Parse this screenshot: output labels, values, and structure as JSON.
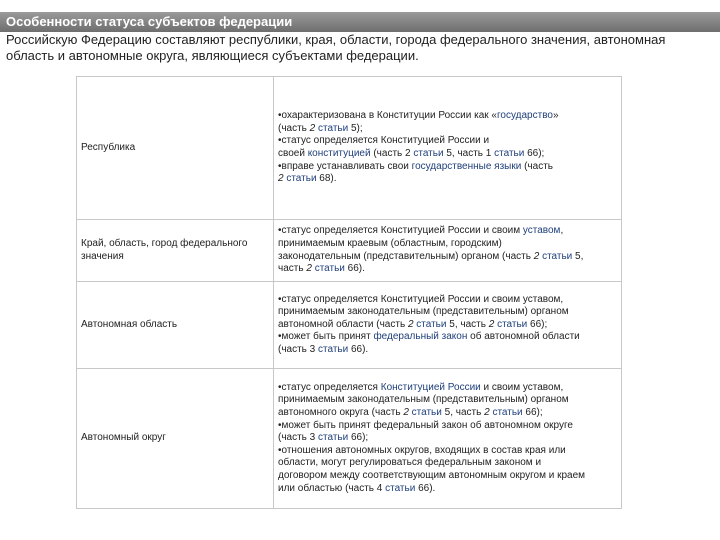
{
  "title": "Особенности статуса субъектов федерации",
  "intro": "Российскую Федерацию составляют республики, края, области, города федерального значения, автономная область и автономные округа, являющиеся субъектами федерации.",
  "rows": [
    {
      "name": "Республика",
      "lines": [
        [
          {
            "t": "•охарактеризована в Конституции России как «"
          },
          {
            "t": "государство",
            "link": true
          },
          {
            "t": "»"
          }
        ],
        [
          {
            "t": "(часть "
          },
          {
            "t": "2 ",
            "i": true
          },
          {
            "t": "статьи",
            "link": true
          },
          {
            "t": " 5);"
          }
        ],
        [
          {
            "t": "•статус определяется Конституцией России и"
          }
        ],
        [
          {
            "t": "своей "
          },
          {
            "t": "конституцией",
            "link": true
          },
          {
            "t": " (часть 2 "
          },
          {
            "t": "статьи",
            "link": true
          },
          {
            "t": " 5, часть 1 "
          },
          {
            "t": "статьи",
            "link": true
          },
          {
            "t": " 66);"
          }
        ],
        [
          {
            "t": "•вправе устанавливать свои "
          },
          {
            "t": "государственные языки",
            "link": true
          },
          {
            "t": " (часть"
          }
        ],
        [
          {
            "t": "2 ",
            "i": true
          },
          {
            "t": "статьи",
            "link": true
          },
          {
            "t": " 68)."
          }
        ]
      ]
    },
    {
      "name": "Край, область, город федерального значения",
      "lines": [
        [
          {
            "t": "•статус определяется Конституцией России и своим "
          },
          {
            "t": "уставом",
            "link": true
          },
          {
            "t": ","
          }
        ],
        [
          {
            "t": "принимаемым краевым (областным, городским)"
          }
        ],
        [
          {
            "t": "законодательным (представительным) органом (часть "
          },
          {
            "t": "2 ",
            "i": true
          },
          {
            "t": "статьи",
            "link": true
          },
          {
            "t": " 5,"
          }
        ],
        [
          {
            "t": "часть "
          },
          {
            "t": "2 ",
            "i": true
          },
          {
            "t": "статьи",
            "link": true
          },
          {
            "t": " 66)."
          }
        ]
      ]
    },
    {
      "name": "Автономная область",
      "lines": [
        [
          {
            "t": "•статус определяется Конституцией России и своим уставом,"
          }
        ],
        [
          {
            "t": "принимаемым законодательным (представительным) органом"
          }
        ],
        [
          {
            "t": "автономной области (часть "
          },
          {
            "t": "2 ",
            "i": true
          },
          {
            "t": "статьи",
            "link": true
          },
          {
            "t": " 5, часть "
          },
          {
            "t": "2 ",
            "i": true
          },
          {
            "t": "статьи",
            "link": true
          },
          {
            "t": " 66);"
          }
        ],
        [
          {
            "t": "•может быть принят "
          },
          {
            "t": "федеральный закон",
            "link": true
          },
          {
            "t": " об автономной области"
          }
        ],
        [
          {
            "t": "(часть 3 "
          },
          {
            "t": "статьи",
            "link": true
          },
          {
            "t": " 66)."
          }
        ]
      ]
    },
    {
      "name": "Автономный округ",
      "lines": [
        [
          {
            "t": "•статус определяется "
          },
          {
            "t": "Конституцией России",
            "link": true
          },
          {
            "t": " и своим уставом,"
          }
        ],
        [
          {
            "t": "принимаемым законодательным (представительным) органом"
          }
        ],
        [
          {
            "t": "автономного округа (часть "
          },
          {
            "t": "2 ",
            "i": true
          },
          {
            "t": "статьи",
            "link": true
          },
          {
            "t": " 5, часть "
          },
          {
            "t": "2 ",
            "i": true
          },
          {
            "t": "статьи",
            "link": true
          },
          {
            "t": " 66);"
          }
        ],
        [
          {
            "t": "•может быть принят федеральный закон об автономном округе"
          }
        ],
        [
          {
            "t": "(часть 3 "
          },
          {
            "t": "статьи",
            "link": true
          },
          {
            "t": " 66);"
          }
        ],
        [
          {
            "t": "•отношения автономных округов, входящих в состав края или"
          }
        ],
        [
          {
            "t": "области, могут регулироваться федеральным законом и"
          }
        ],
        [
          {
            "t": "договором между соответствующим автономным округом и краем"
          }
        ],
        [
          {
            "t": "или областью (часть 4 "
          },
          {
            "t": "статьи",
            "link": true
          },
          {
            "t": " 66)."
          }
        ]
      ]
    }
  ]
}
